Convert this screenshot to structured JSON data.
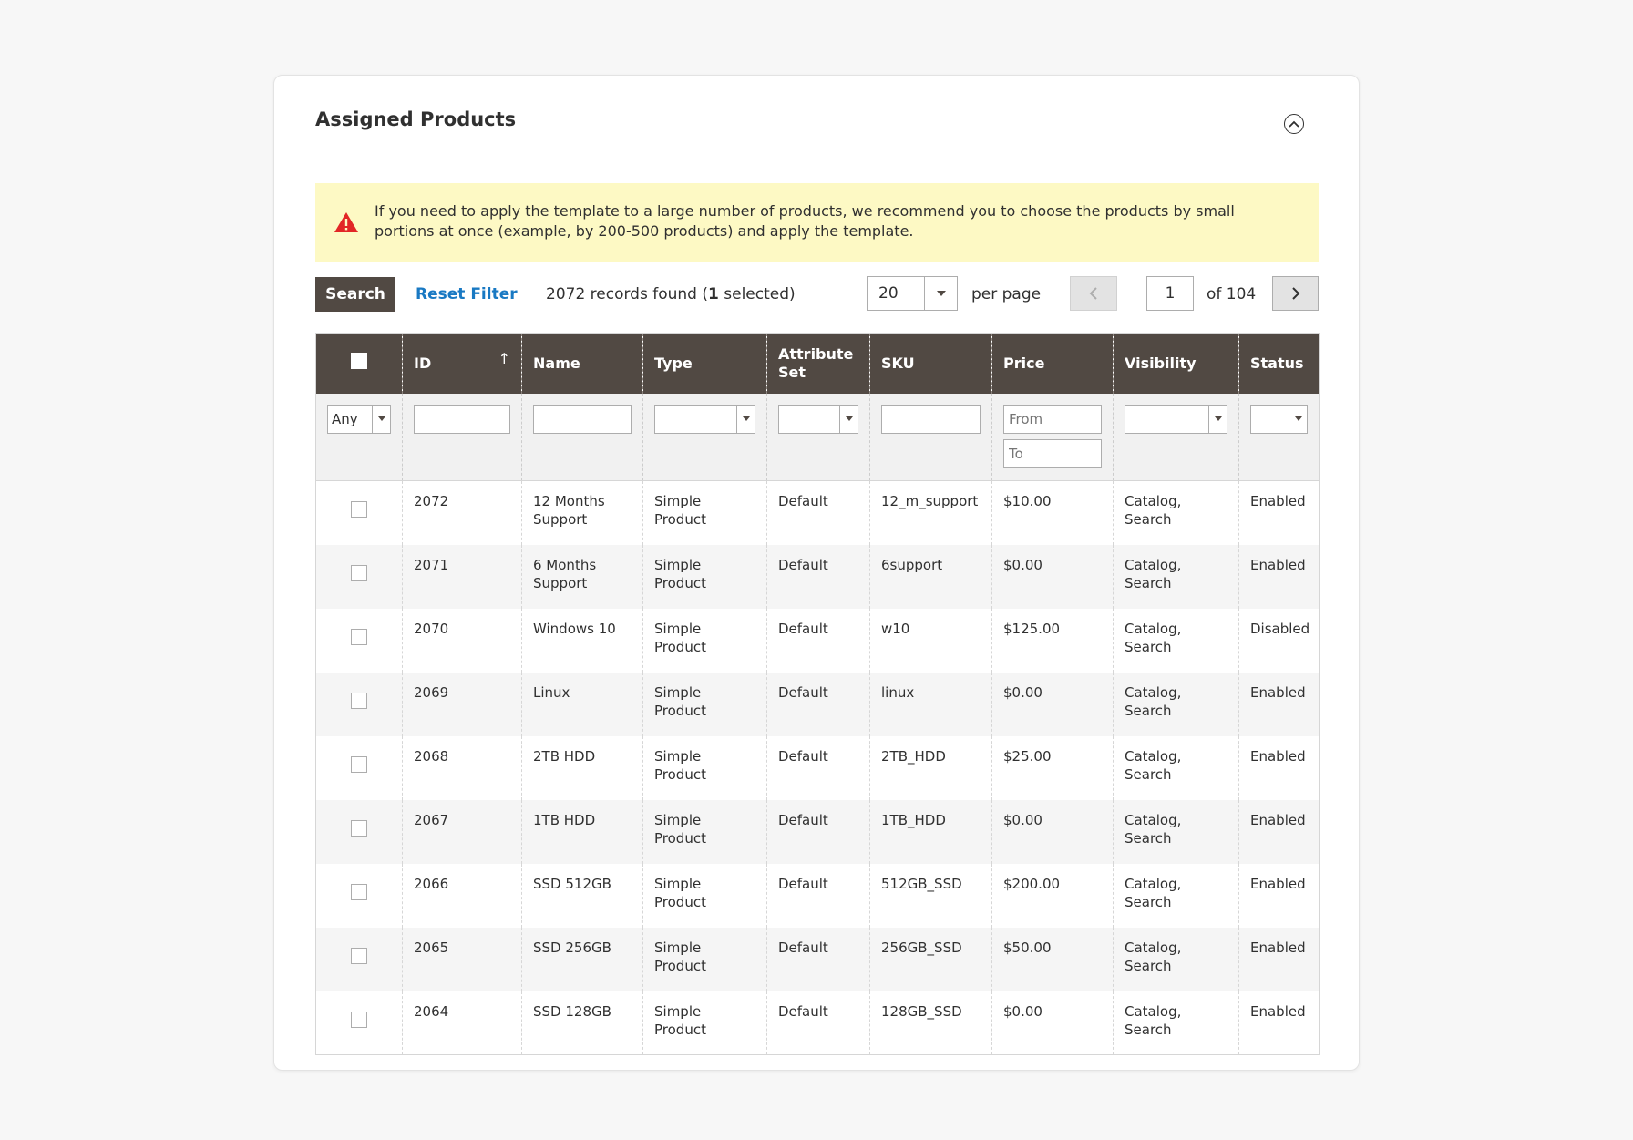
{
  "panel": {
    "title": "Assigned Products",
    "collapse_icon": "chevron-up-circle-icon"
  },
  "notice": {
    "icon": "warning-icon",
    "color": "#e22626",
    "text": "If you need to apply the template to a large number of products, we recommend you to choose the products by small portions at once (example, by 200-500 products) and apply the template."
  },
  "toolbar": {
    "search_label": "Search",
    "reset_label": "Reset Filter",
    "records_count": "2072",
    "records_pre": " records found (",
    "selected_count": "1",
    "selected_post": " selected)",
    "per_page_value": "20",
    "per_page_label": "per page",
    "current_page": "1",
    "total_pages": "of 104"
  },
  "grid": {
    "columns": [
      "ID",
      "Name",
      "Type",
      "Attribute Set",
      "SKU",
      "Price",
      "Visibility",
      "Status"
    ],
    "sort_indicator": "↑",
    "filters": {
      "selection": "Any",
      "price_from_placeholder": "From",
      "price_to_placeholder": "To"
    },
    "rows": [
      {
        "id": "2072",
        "name": "12 Months Support",
        "type": "Simple Product",
        "attribute_set": "Default",
        "sku": "12_m_support",
        "price": "$10.00",
        "visibility": "Catalog, Search",
        "status": "Enabled"
      },
      {
        "id": "2071",
        "name": "6 Months Support",
        "type": "Simple Product",
        "attribute_set": "Default",
        "sku": "6support",
        "price": "$0.00",
        "visibility": "Catalog, Search",
        "status": "Enabled"
      },
      {
        "id": "2070",
        "name": "Windows 10",
        "type": "Simple Product",
        "attribute_set": "Default",
        "sku": "w10",
        "price": "$125.00",
        "visibility": "Catalog, Search",
        "status": "Disabled"
      },
      {
        "id": "2069",
        "name": "Linux",
        "type": "Simple Product",
        "attribute_set": "Default",
        "sku": "linux",
        "price": "$0.00",
        "visibility": "Catalog, Search",
        "status": "Enabled"
      },
      {
        "id": "2068",
        "name": "2TB HDD",
        "type": "Simple Product",
        "attribute_set": "Default",
        "sku": "2TB_HDD",
        "price": "$25.00",
        "visibility": "Catalog, Search",
        "status": "Enabled"
      },
      {
        "id": "2067",
        "name": "1TB HDD",
        "type": "Simple Product",
        "attribute_set": "Default",
        "sku": "1TB_HDD",
        "price": "$0.00",
        "visibility": "Catalog, Search",
        "status": "Enabled"
      },
      {
        "id": "2066",
        "name": "SSD 512GB",
        "type": "Simple Product",
        "attribute_set": "Default",
        "sku": "512GB_SSD",
        "price": "$200.00",
        "visibility": "Catalog, Search",
        "status": "Enabled"
      },
      {
        "id": "2065",
        "name": "SSD 256GB",
        "type": "Simple Product",
        "attribute_set": "Default",
        "sku": "256GB_SSD",
        "price": "$50.00",
        "visibility": "Catalog, Search",
        "status": "Enabled"
      },
      {
        "id": "2064",
        "name": "SSD 128GB",
        "type": "Simple Product",
        "attribute_set": "Default",
        "sku": "128GB_SSD",
        "price": "$0.00",
        "visibility": "Catalog, Search",
        "status": "Enabled"
      }
    ]
  },
  "colors": {
    "header_bg": "#514943",
    "notice_bg": "#fdf9c4",
    "link": "#1979c3",
    "row_alt": "#f5f5f5"
  }
}
